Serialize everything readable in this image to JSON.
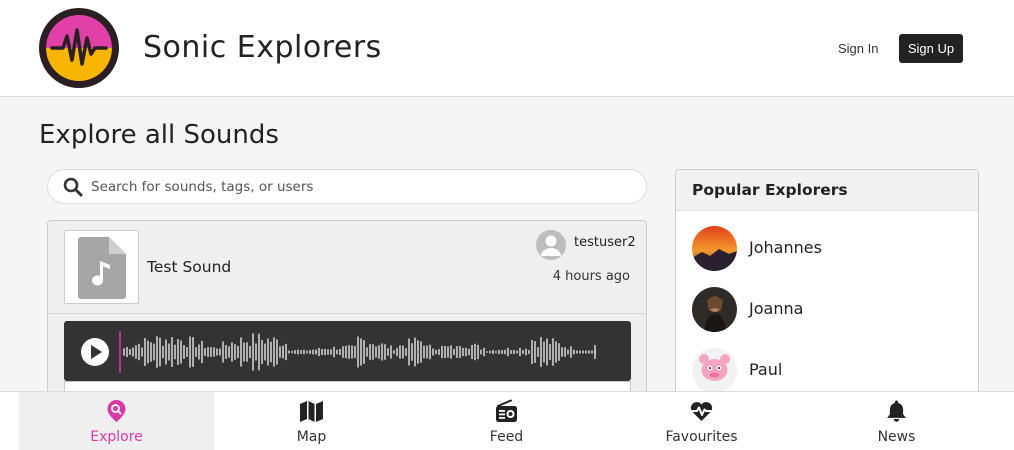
{
  "header": {
    "app_title": "Sonic Explorers",
    "sign_in_label": "Sign In",
    "sign_up_label": "Sign Up"
  },
  "main": {
    "page_title": "Explore all Sounds",
    "search": {
      "placeholder": "Search for sounds, tags, or users",
      "value": ""
    },
    "sounds": [
      {
        "title": "Test Sound",
        "user": "testuser2",
        "time": "4 hours ago"
      }
    ]
  },
  "popular": {
    "title": "Popular Explorers",
    "explorers": [
      {
        "name": "Johannes"
      },
      {
        "name": "Joanna"
      },
      {
        "name": "Paul"
      }
    ]
  },
  "nav": {
    "items": [
      {
        "label": "Explore",
        "icon": "map-pin-search-icon",
        "active": true
      },
      {
        "label": "Map",
        "icon": "map-icon"
      },
      {
        "label": "Feed",
        "icon": "radio-icon"
      },
      {
        "label": "Favourites",
        "icon": "heart-pulse-icon"
      },
      {
        "label": "News",
        "icon": "bell-icon"
      }
    ]
  },
  "colors": {
    "accent": "#d63aa8",
    "logo_top": "#e040a8",
    "logo_bottom": "#f7b500",
    "dark": "#222222"
  }
}
